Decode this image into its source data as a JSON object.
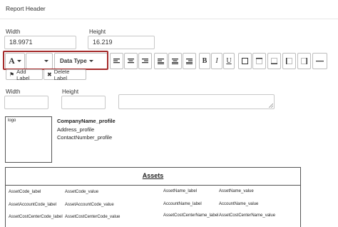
{
  "header": {
    "title": "Report Header"
  },
  "dimensions": {
    "width_label": "Width",
    "width_value": "18.9971",
    "height_label": "Height",
    "height_value": "16.219"
  },
  "toolbar": {
    "font_label": "A",
    "data_type_label": "Data Type",
    "bold": "B",
    "italic": "I",
    "underline": "U"
  },
  "actions": {
    "add_label": "Add Label",
    "delete_label": "Delete Label"
  },
  "element_props": {
    "width_label": "Width",
    "height_label": "Height"
  },
  "report": {
    "logo": "logo",
    "company": "CompanyName_profile",
    "address": "Address_profile",
    "contact": "ContactNumber_profile",
    "assets_title": "Assets",
    "rows": [
      [
        "AssetCode_label",
        "AssetCode_value",
        "AssetName_label",
        "AssetName_value"
      ],
      [
        "AssetAccountCode_label",
        "AssetAccountCode_value",
        "AccountName_label",
        "AccountName_value"
      ],
      [
        "AssetCostCenterCode_label",
        "AssetCostCenterCode_value",
        "AssetCostCenterName_label",
        "AssetCostCenterName_value"
      ]
    ]
  },
  "colors": {
    "highlight": "#a52a2a",
    "border": "#bdbdbd"
  }
}
